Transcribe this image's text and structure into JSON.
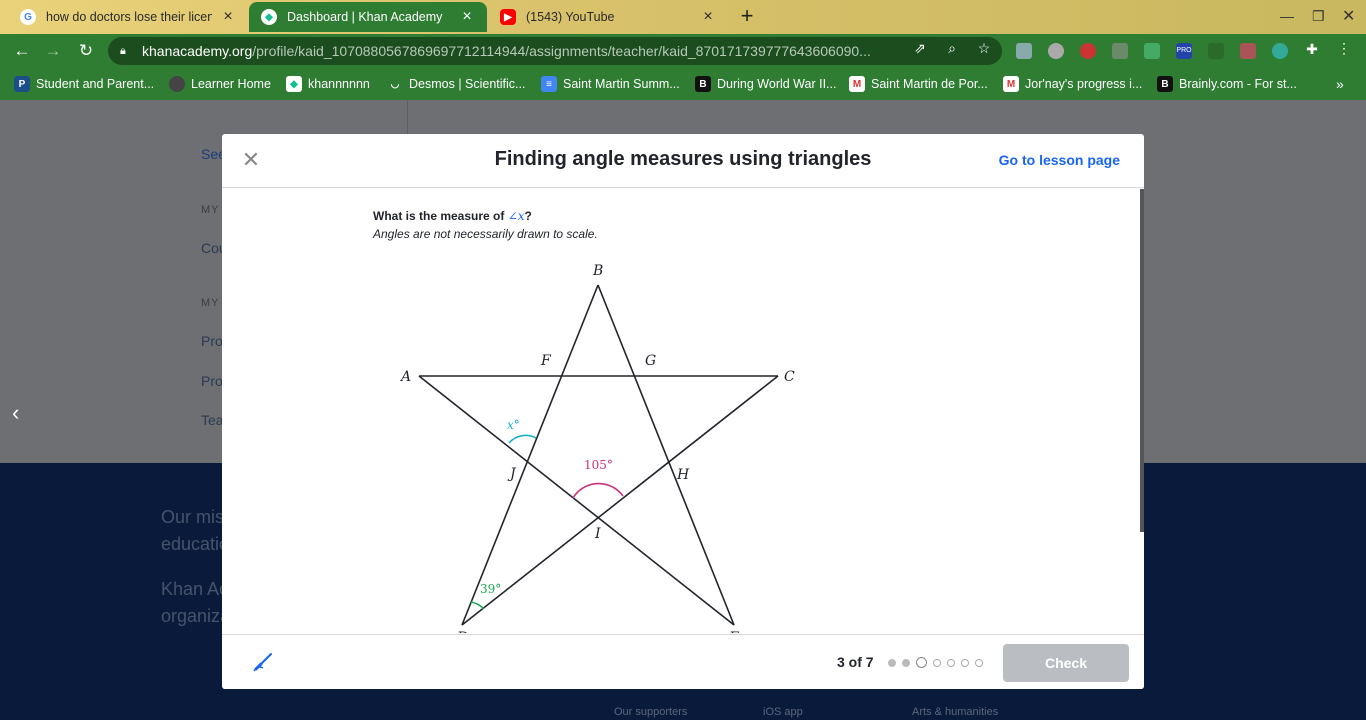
{
  "browser": {
    "tabs": [
      {
        "title": "how do doctors lose their license",
        "icon": "google-icon"
      },
      {
        "title": "Dashboard | Khan Academy",
        "icon": "khan-icon"
      },
      {
        "title": "(1543) YouTube",
        "icon": "youtube-icon"
      }
    ],
    "url_host": "khanacademy.org",
    "url_path": "/profile/kaid_1070880567869697712114944/assignments/teacher/kaid_870171739777643606090...",
    "bookmarks": [
      "Student and Parent...",
      "Learner Home",
      "khannnnnn",
      "Desmos | Scientific...",
      "Saint Martin Summ...",
      "During World War II...",
      "Saint Martin de Por...",
      "Jor'nay's progress i...",
      "Brainly.com - For st..."
    ],
    "ext_badge": "PRO"
  },
  "background": {
    "see_text": "See",
    "my_label_1": "MY",
    "co_text": "Cou",
    "my_label_2": "MY",
    "pro_1": "Pro",
    "pro_2": "Pro",
    "tea": "Tea",
    "footer_line1": "Our mis",
    "footer_line2": "educatio",
    "footer_line3": "Khan Ac",
    "footer_line4": "organiza",
    "footer_links": [
      "Our supporters",
      "iOS app",
      "Arts & humanities"
    ]
  },
  "modal": {
    "title": "Finding angle measures using triangles",
    "lesson_link": "Go to lesson page",
    "question_prefix": "What is the measure of",
    "question_angle": "∠x",
    "question_suffix": "?",
    "note": "Angles are not necessarily drawn to scale.",
    "progress": "3 of 7",
    "progress_current": 3,
    "progress_total": 7,
    "check_label": "Check"
  },
  "diagram": {
    "points": {
      "A": "A",
      "B": "B",
      "C": "C",
      "F": "F",
      "G": "G",
      "H": "H",
      "I": "I",
      "J": "J",
      "D": "D",
      "E": "E"
    },
    "angle_x": "x°",
    "angle_105": "105°",
    "angle_39": "39°",
    "colors": {
      "x": "#11accd",
      "a105": "#ca337c",
      "a39": "#1fab54"
    }
  }
}
